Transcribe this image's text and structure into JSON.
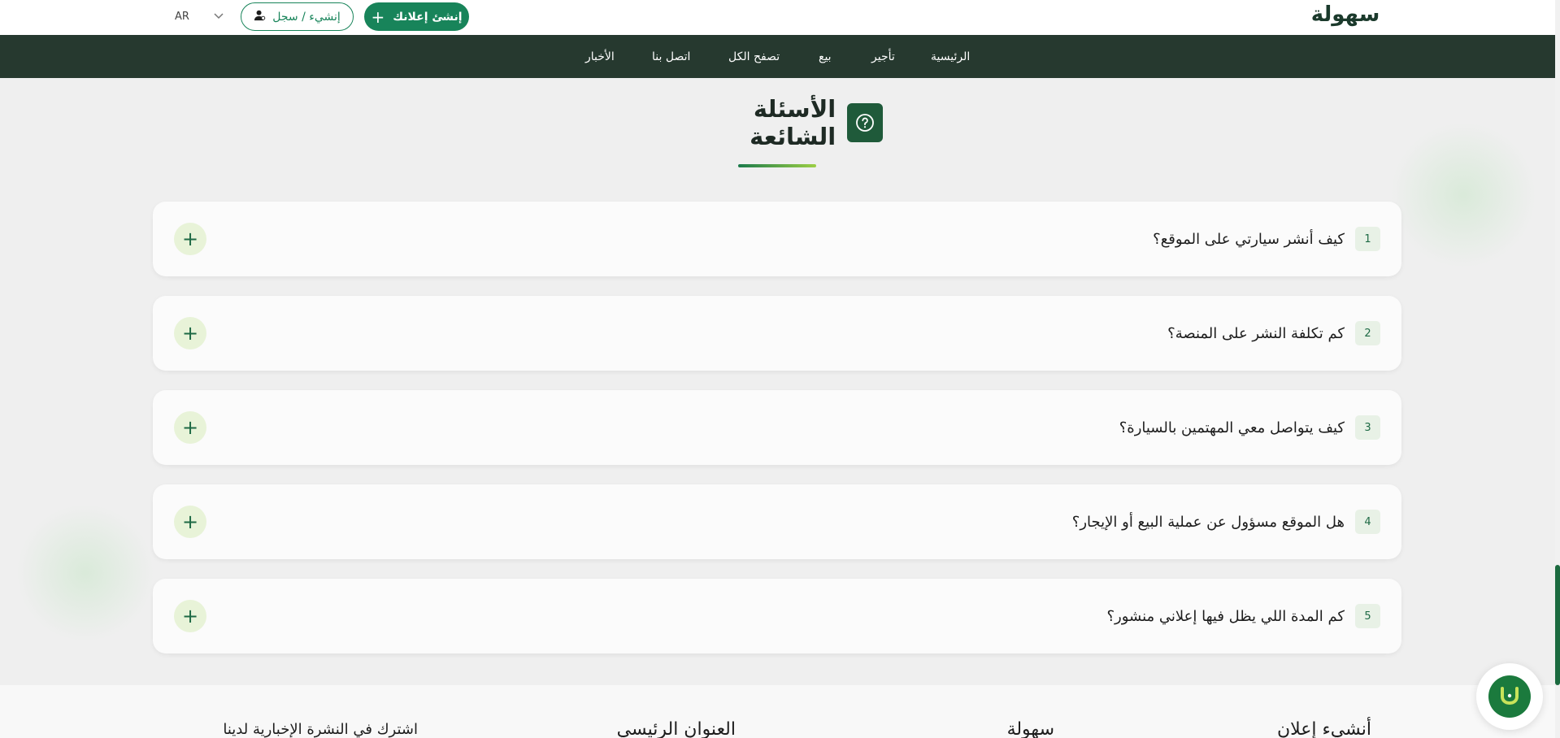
{
  "header": {
    "logo_text": "سهولة",
    "language": "AR",
    "login_label": "إنشيء / سجل",
    "create_ad_label": "إنشئ إعلانك"
  },
  "nav": {
    "items": [
      {
        "label": "الرئيسية"
      },
      {
        "label": "تأجير"
      },
      {
        "label": "بيع"
      },
      {
        "label": "تصفح الكل"
      },
      {
        "label": "اتصل بنا"
      },
      {
        "label": "الأخبار"
      }
    ]
  },
  "faq": {
    "title": "الأسئلة الشائعة",
    "items": [
      {
        "num": "1",
        "question": "كيف أنشر سيارتي على الموقع؟"
      },
      {
        "num": "2",
        "question": "كم تكلفة النشر على المنصة؟"
      },
      {
        "num": "3",
        "question": "كيف يتواصل معي المهتمين بالسيارة؟"
      },
      {
        "num": "4",
        "question": "هل الموقع مسؤول عن عملية البيع أو الإيجار؟"
      },
      {
        "num": "5",
        "question": "كم المدة اللي يظل فيها إعلاني منشور؟"
      }
    ]
  },
  "footer": {
    "col1": "أنشيء إعلان",
    "col2": "سهولة",
    "col3": "العنوان الرئيسي",
    "col4": "اشترك في النشرة الإخبارية لدينا"
  },
  "colors": {
    "primary": "#18845a",
    "nav_bg": "#26392f",
    "accent": "#9ccf45"
  }
}
